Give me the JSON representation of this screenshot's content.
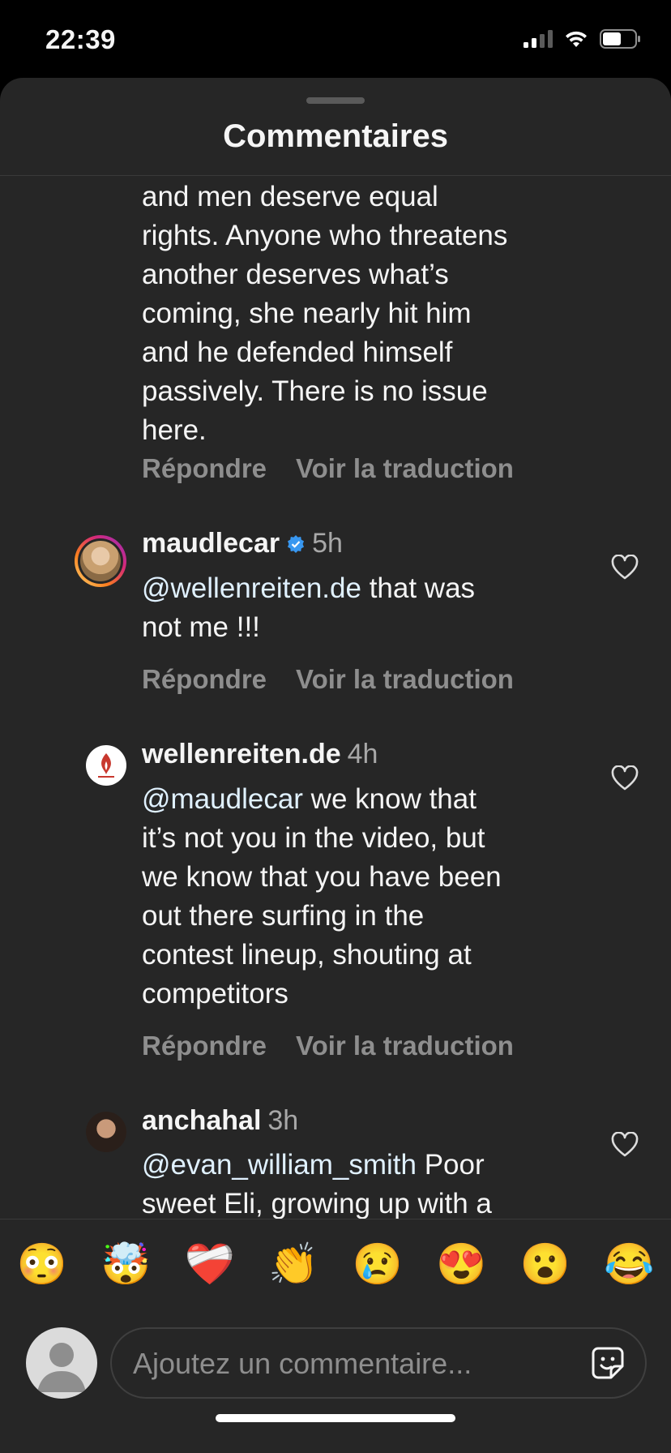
{
  "status_bar": {
    "time": "22:39"
  },
  "sheet": {
    "title": "Commentaires"
  },
  "partial_comment": {
    "lines": [
      "and men deserve equal",
      "rights. Anyone who threatens",
      "another deserves what’s",
      "coming, she nearly hit him",
      "and he defended himself",
      "passively. There is no issue",
      "here."
    ],
    "reply_label": "Répondre",
    "translate_label": "Voir la traduction"
  },
  "comments": [
    {
      "username": "maudlecar",
      "verified": true,
      "time": "5h",
      "mention": "@wellenreiten.de",
      "lines": [
        " that was",
        "not me !!!"
      ],
      "reply_label": "Répondre",
      "translate_label": "Voir la traduction"
    },
    {
      "username": "wellenreiten.de",
      "verified": false,
      "time": "4h",
      "mention": "@maudlecar",
      "lines": [
        " we know that",
        "it’s not you in the video, but",
        "we know that you have been",
        "out there surfing in the",
        "contest lineup, shouting at",
        "competitors"
      ],
      "reply_label": "Répondre",
      "translate_label": "Voir la traduction"
    },
    {
      "username": "anchahal",
      "verified": false,
      "time": "3h",
      "mention": "@evan_william_smith",
      "lines": [
        " Poor",
        "sweet Eli, growing up with a"
      ]
    }
  ],
  "emoji_bar": [
    "😳",
    "🤯",
    "❤️‍🩹",
    "👏",
    "😢",
    "😍",
    "😮",
    "😂"
  ],
  "compose": {
    "placeholder": "Ajoutez un commentaire..."
  },
  "colors": {
    "sheet_bg": "#262626",
    "mention": "#e0f1ff",
    "secondary_text": "#8e8e8e",
    "verified": "#3897f0"
  }
}
